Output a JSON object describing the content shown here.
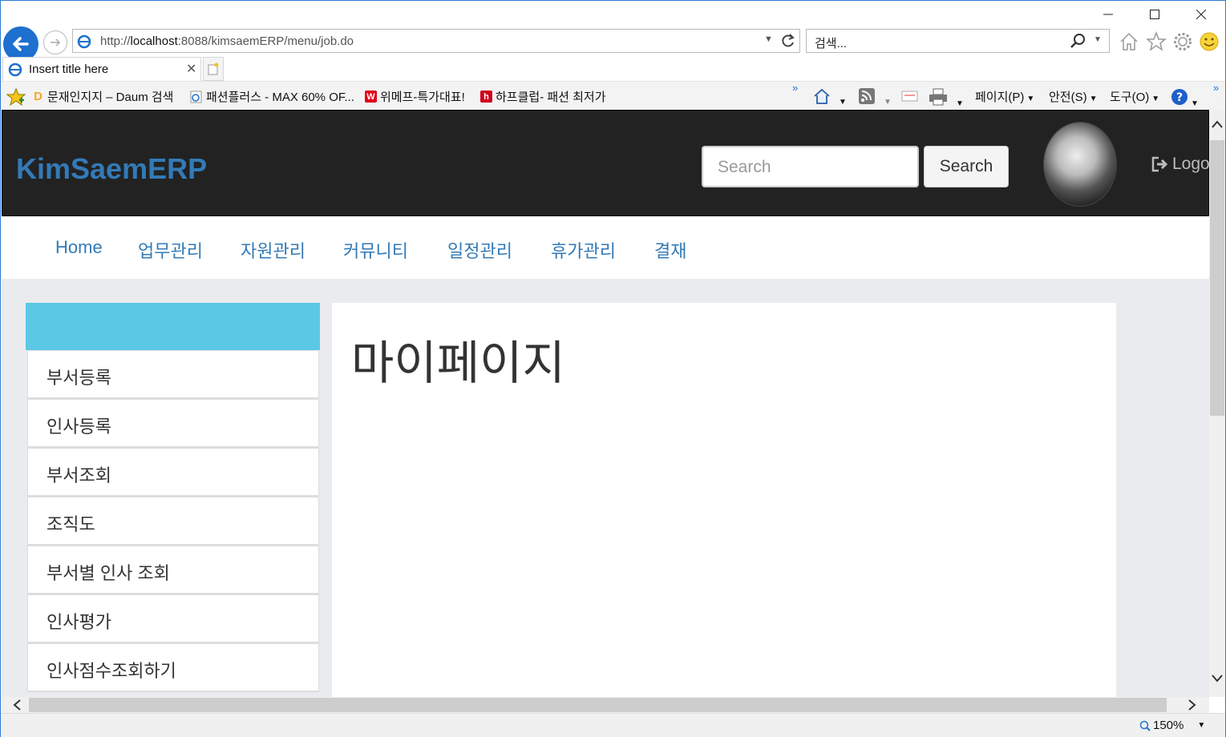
{
  "browser": {
    "address": {
      "prefix": "http://",
      "host": "localhost",
      "rest": ":8088/kimsaemERP/menu/job.do"
    },
    "search_placeholder": "검색...",
    "tab_title": "Insert title here",
    "favorites": [
      {
        "label": "문재인지지 – Daum 검색",
        "icon": "daum-icon",
        "badge": "D",
        "color": "#f5a623"
      },
      {
        "label": "패션플러스 - MAX 60% OF...",
        "icon": "ie-page-icon",
        "badge": "",
        "color": "#1e6fcf"
      },
      {
        "label": "위메프-특가대표!",
        "icon": "wemakeprice-icon",
        "badge": "W",
        "color": "#e0001b"
      },
      {
        "label": "하프클럽- 패션 최저가",
        "icon": "halfclub-icon",
        "badge": "h",
        "color": "#d0021b"
      }
    ],
    "commands": {
      "page": "페이지(P)",
      "safety": "안전(S)",
      "tools": "도구(O)"
    },
    "zoom": "150%"
  },
  "site": {
    "brand": "KimSaemERP",
    "search_placeholder": "Search",
    "search_button": "Search",
    "logout": "Logo",
    "menu": [
      "Home",
      "업무관리",
      "자원관리",
      "커뮤니티",
      "일정관리",
      "휴가관리",
      "결재"
    ],
    "sidebar": [
      "부서등록",
      "인사등록",
      "부서조회",
      "조직도",
      "부서별 인사 조회",
      "인사평가",
      "인사점수조회하기"
    ],
    "page_title": "마이페이지"
  }
}
